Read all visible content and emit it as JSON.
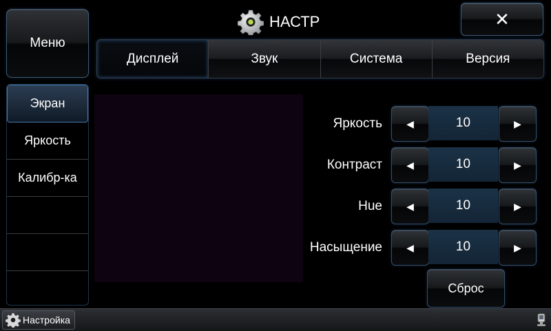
{
  "header": {
    "title": "НАСТР",
    "menu_label": "Меню",
    "close_label": "✕"
  },
  "tabs": [
    {
      "label": "Дисплей",
      "active": true
    },
    {
      "label": "Звук",
      "active": false
    },
    {
      "label": "Система",
      "active": false
    },
    {
      "label": "Версия",
      "active": false
    }
  ],
  "sidebar": {
    "items": [
      {
        "label": "Экран",
        "active": true
      },
      {
        "label": "Яркость",
        "active": false
      },
      {
        "label": "Калибр-ка",
        "active": false
      },
      {
        "label": "",
        "active": false
      },
      {
        "label": "",
        "active": false
      },
      {
        "label": "",
        "active": false
      }
    ]
  },
  "settings": [
    {
      "label": "Яркость",
      "value": "10"
    },
    {
      "label": "Контраст",
      "value": "10"
    },
    {
      "label": "Hue",
      "value": "10"
    },
    {
      "label": "Насыщение",
      "value": "10"
    }
  ],
  "reset_label": "Сброс",
  "taskbar": {
    "app_label": "Настройка"
  },
  "colors": {
    "accent": "#4a7ab0",
    "value_bg": "#1b3246",
    "preview_bg": "#0e0310"
  }
}
